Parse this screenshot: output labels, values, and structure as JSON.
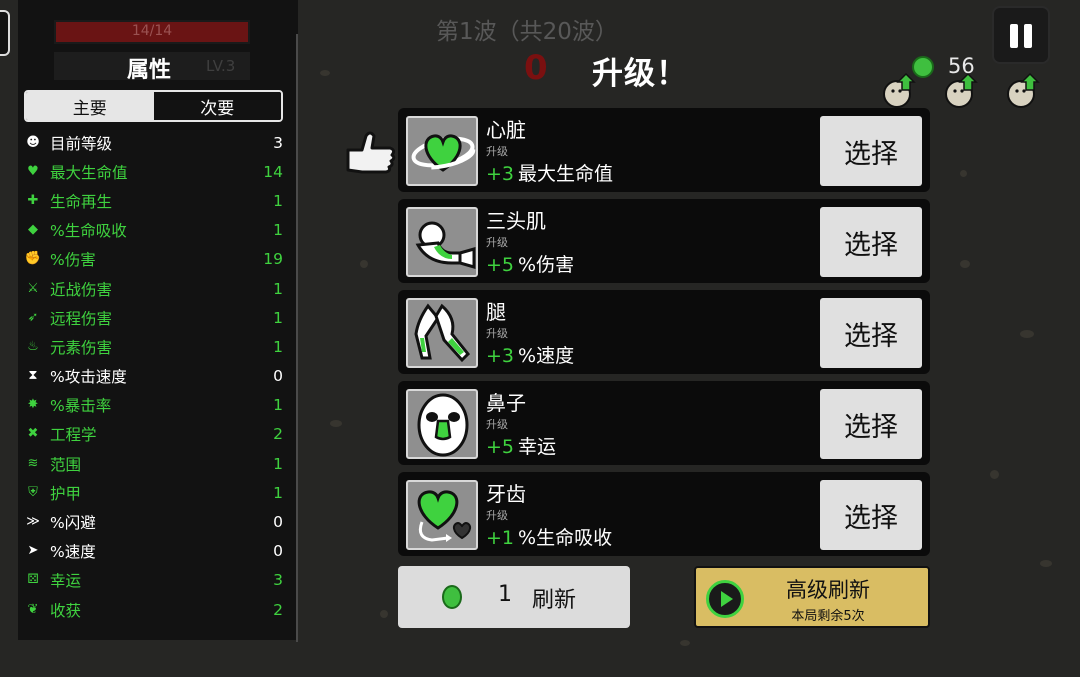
{
  "player": {
    "hp_text": "14/14",
    "hp_fraction": 1.0,
    "level_text": "LV.3"
  },
  "stats_panel": {
    "title": "属性",
    "tabs": [
      {
        "label": "主要",
        "active": true
      },
      {
        "label": "次要",
        "active": false
      }
    ],
    "stats": [
      {
        "icon": "level-icon",
        "glyph": "☻",
        "color": "#ffffff",
        "name": "目前等级",
        "value": "3"
      },
      {
        "icon": "heart-icon",
        "glyph": "♥",
        "color": "#3fd23f",
        "name": "最大生命值",
        "value": "14"
      },
      {
        "icon": "regen-icon",
        "glyph": "✚",
        "color": "#3fd23f",
        "name": "生命再生",
        "value": "1"
      },
      {
        "icon": "lifesteal-icon",
        "glyph": "◆",
        "color": "#3fd23f",
        "name": "%生命吸收",
        "value": "1"
      },
      {
        "icon": "damage-icon",
        "glyph": "✊",
        "color": "#3fd23f",
        "name": "%伤害",
        "value": "19"
      },
      {
        "icon": "melee-icon",
        "glyph": "⚔",
        "color": "#3fd23f",
        "name": "近战伤害",
        "value": "1"
      },
      {
        "icon": "ranged-icon",
        "glyph": "➶",
        "color": "#3fd23f",
        "name": "远程伤害",
        "value": "1"
      },
      {
        "icon": "elemental-icon",
        "glyph": "♨",
        "color": "#3fd23f",
        "name": "元素伤害",
        "value": "1"
      },
      {
        "icon": "attack-speed-icon",
        "glyph": "⧗",
        "color": "#ffffff",
        "name": "%攻击速度",
        "value": "0"
      },
      {
        "icon": "crit-icon",
        "glyph": "✸",
        "color": "#3fd23f",
        "name": "%暴击率",
        "value": "1"
      },
      {
        "icon": "engineering-icon",
        "glyph": "✖",
        "color": "#3fd23f",
        "name": "工程学",
        "value": "2"
      },
      {
        "icon": "range-icon",
        "glyph": "≋",
        "color": "#3fd23f",
        "name": "范围",
        "value": "1"
      },
      {
        "icon": "armor-icon",
        "glyph": "⛨",
        "color": "#3fd23f",
        "name": "护甲",
        "value": "1"
      },
      {
        "icon": "dodge-icon",
        "glyph": "≫",
        "color": "#ffffff",
        "name": "%闪避",
        "value": "0"
      },
      {
        "icon": "speed-icon",
        "glyph": "➤",
        "color": "#ffffff",
        "name": "%速度",
        "value": "0"
      },
      {
        "icon": "luck-icon",
        "glyph": "⚄",
        "color": "#3fd23f",
        "name": "幸运",
        "value": "3"
      },
      {
        "icon": "harvest-icon",
        "glyph": "❦",
        "color": "#3fd23f",
        "name": "收获",
        "value": "2"
      }
    ]
  },
  "wave": {
    "text": "第1波（共20波）",
    "timer": "0"
  },
  "level_up": {
    "title": "升级！"
  },
  "materials": {
    "count": "56"
  },
  "upgrades": [
    {
      "name": "心脏",
      "sub": "升级",
      "amount": "+3",
      "stat": "最大生命值",
      "button": "选择",
      "icon": "heart-organ-icon"
    },
    {
      "name": "三头肌",
      "sub": "升级",
      "amount": "+5",
      "stat": "%伤害",
      "button": "选择",
      "icon": "triceps-icon"
    },
    {
      "name": "腿",
      "sub": "升级",
      "amount": "+3",
      "stat": "%速度",
      "button": "选择",
      "icon": "legs-icon"
    },
    {
      "name": "鼻子",
      "sub": "升级",
      "amount": "+5",
      "stat": "幸运",
      "button": "选择",
      "icon": "nose-icon"
    },
    {
      "name": "牙齿",
      "sub": "升级",
      "amount": "+1",
      "stat": "%生命吸收",
      "button": "选择",
      "icon": "teeth-icon"
    }
  ],
  "reroll": {
    "cost": "1",
    "label": "刷新"
  },
  "premium_reroll": {
    "title": "高级刷新",
    "remaining": "本局剩余5次"
  },
  "colors": {
    "positive": "#3fd23f",
    "gold": "#d9bd63",
    "hp_red": "#6a1414"
  }
}
